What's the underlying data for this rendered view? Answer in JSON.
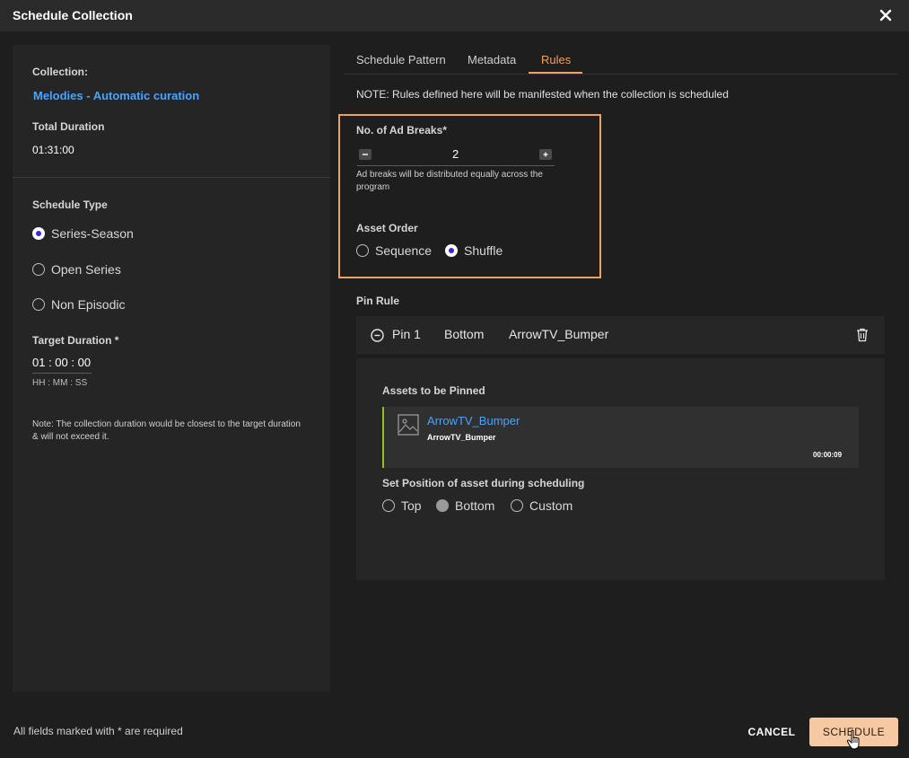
{
  "dialog": {
    "title": "Schedule Collection"
  },
  "left": {
    "collection_label": "Collection:",
    "collection_name": "Melodies - Automatic curation",
    "total_duration_label": "Total Duration",
    "total_duration_value": "01:31:00",
    "schedule_type_label": "Schedule Type",
    "schedule_types": [
      {
        "label": "Series-Season",
        "checked": true
      },
      {
        "label": "Open Series",
        "checked": false
      },
      {
        "label": "Non Episodic",
        "checked": false
      }
    ],
    "target_duration_label": "Target Duration *",
    "target_duration_value": "01 : 00 : 00",
    "target_duration_hint": "HH : MM : SS",
    "note": "Note: The collection duration would be closest to the target duration & will not exceed it."
  },
  "tabs": [
    {
      "label": "Schedule Pattern",
      "active": false
    },
    {
      "label": "Metadata",
      "active": false
    },
    {
      "label": "Rules",
      "active": true
    }
  ],
  "rules": {
    "note": "NOTE: Rules defined here will be manifested when the collection is scheduled",
    "ad_breaks_label": "No. of Ad Breaks*",
    "ad_breaks_value": "2",
    "ad_breaks_note": "Ad breaks will be distributed equally across the program",
    "asset_order_label": "Asset Order",
    "asset_order_options": [
      {
        "label": "Sequence",
        "checked": false
      },
      {
        "label": "Shuffle",
        "checked": true
      }
    ],
    "pin_rule_label": "Pin Rule",
    "pin": {
      "name": "Pin 1",
      "position": "Bottom",
      "asset": "ArrowTV_Bumper",
      "assets_label": "Assets to be Pinned",
      "asset_title": "ArrowTV_Bumper",
      "asset_subtitle": "ArrowTV_Bumper",
      "asset_duration": "00:00:09",
      "set_position_label": "Set Position of asset during scheduling",
      "position_options": [
        {
          "label": "Top",
          "checked": false
        },
        {
          "label": "Bottom",
          "checked": true
        },
        {
          "label": "Custom",
          "checked": false
        }
      ]
    }
  },
  "footer": {
    "required_note": "All fields marked with * are required",
    "cancel_label": "CANCEL",
    "schedule_label": "SCHEDULE"
  },
  "colors": {
    "accent": "#f2a05a",
    "link": "#4aa3ff",
    "radio_selected": "#3a26d6",
    "asset_bar": "#8fbf2a"
  }
}
